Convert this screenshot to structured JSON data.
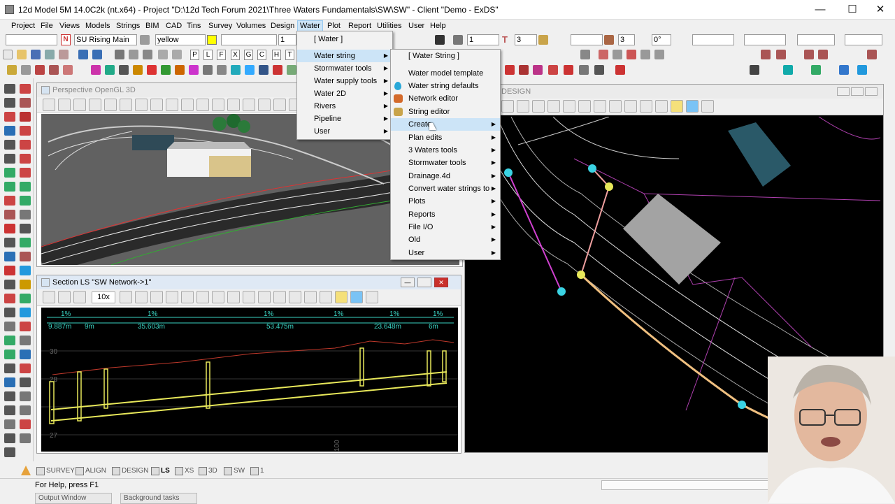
{
  "window": {
    "title": "12d Model 5M 14.0C2k (nt.x64) - Project \"D:\\12d Tech Forum 2021\\Three Waters Fundamentals\\SW\\SW\" - Client \"Demo - ExDS\"",
    "min": "—",
    "max": "☐",
    "close": "✕"
  },
  "menubar": [
    "Project",
    "File",
    "Views",
    "Models",
    "Strings",
    "BIM",
    "CAD",
    "Tins",
    "Survey",
    "Volumes",
    "Design",
    "Water",
    "Plot",
    "Report",
    "Utilities",
    "User",
    "Help"
  ],
  "toolbar": {
    "model_name": "SU Rising Main",
    "colour": "yellow",
    "colour_hex": "#ffff00",
    "field_1": "1",
    "field_2": "1",
    "field_3": "3",
    "field_4": "3",
    "field_5": "0°",
    "n_badge": "N",
    "letters": [
      "P",
      "L",
      "F",
      "X",
      "G",
      "C",
      "H",
      "T"
    ]
  },
  "water_menu": {
    "header": "[ Water ]",
    "items": [
      "Water string",
      "Stormwater tools",
      "Water supply tools",
      "Water 2D",
      "Rivers",
      "Pipeline",
      "User"
    ]
  },
  "water_string_menu": {
    "header": "[ Water String ]",
    "items": [
      "Water model template",
      "Water string defaults",
      "Network editor",
      "String editor",
      "Create",
      "Plan edits",
      "3 Waters tools",
      "Stormwater tools",
      "Drainage.4d",
      "Convert water strings to",
      "Plots",
      "Reports",
      "File I/O",
      "Old",
      "User"
    ]
  },
  "views": {
    "perspective": {
      "title": "Perspective OpenGL 3D"
    },
    "section": {
      "title": "Section LS \"SW Network->1\"",
      "zoom": "10x",
      "grades": [
        "1%",
        "1%",
        "1%",
        "1%",
        "1%",
        "1%"
      ],
      "lengths": [
        "9.887m",
        "9m",
        "35.603m",
        "53.475m",
        "23.648m",
        "6m"
      ],
      "y_labels": [
        "30",
        "28",
        "27"
      ],
      "x_label": "100"
    },
    "plan": {
      "title": "DESIGN"
    }
  },
  "view_tabs": [
    "SURVEY",
    "ALIGN",
    "DESIGN",
    "LS",
    "XS",
    "3D",
    "SW",
    "1"
  ],
  "status": {
    "help": "For Help, press F1",
    "output": "Output Window",
    "background": "Background tasks"
  }
}
